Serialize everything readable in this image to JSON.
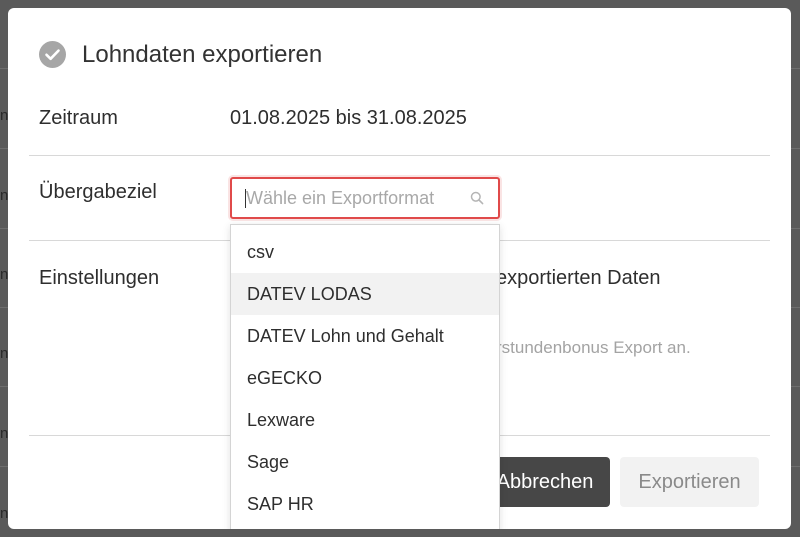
{
  "dialog": {
    "title": "Lohndaten exportieren",
    "title_icon": "check-circle-icon"
  },
  "period": {
    "label": "Zeitraum",
    "value": "01.08.2025 bis 31.08.2025"
  },
  "target": {
    "label": "Übergabeziel",
    "input_value": "",
    "placeholder": "Wähle ein Exportformat",
    "search_icon": "search-icon"
  },
  "settings": {
    "label": "Einstellungen",
    "partial_text_1": "exportierten Daten",
    "partial_text_2": "rstundenbonus Export an."
  },
  "dropdown": {
    "highlighted_index": 1,
    "options": [
      {
        "label": "csv"
      },
      {
        "label": "DATEV LODAS"
      },
      {
        "label": "DATEV Lohn und Gehalt"
      },
      {
        "label": "eGECKO"
      },
      {
        "label": "Lexware"
      },
      {
        "label": "Sage"
      },
      {
        "label": "SAP HR"
      }
    ]
  },
  "buttons": {
    "cancel_label": "Abbrechen",
    "export_label": "Exportieren"
  },
  "backdrop": {
    "glyph": "n"
  },
  "colors": {
    "backdrop": "#5a5a5a",
    "input_error_border": "#e04a4a",
    "cancel_button_bg": "#474747",
    "export_button_bg": "#f2f2f2",
    "highlight_bg": "#f2f2f2"
  }
}
